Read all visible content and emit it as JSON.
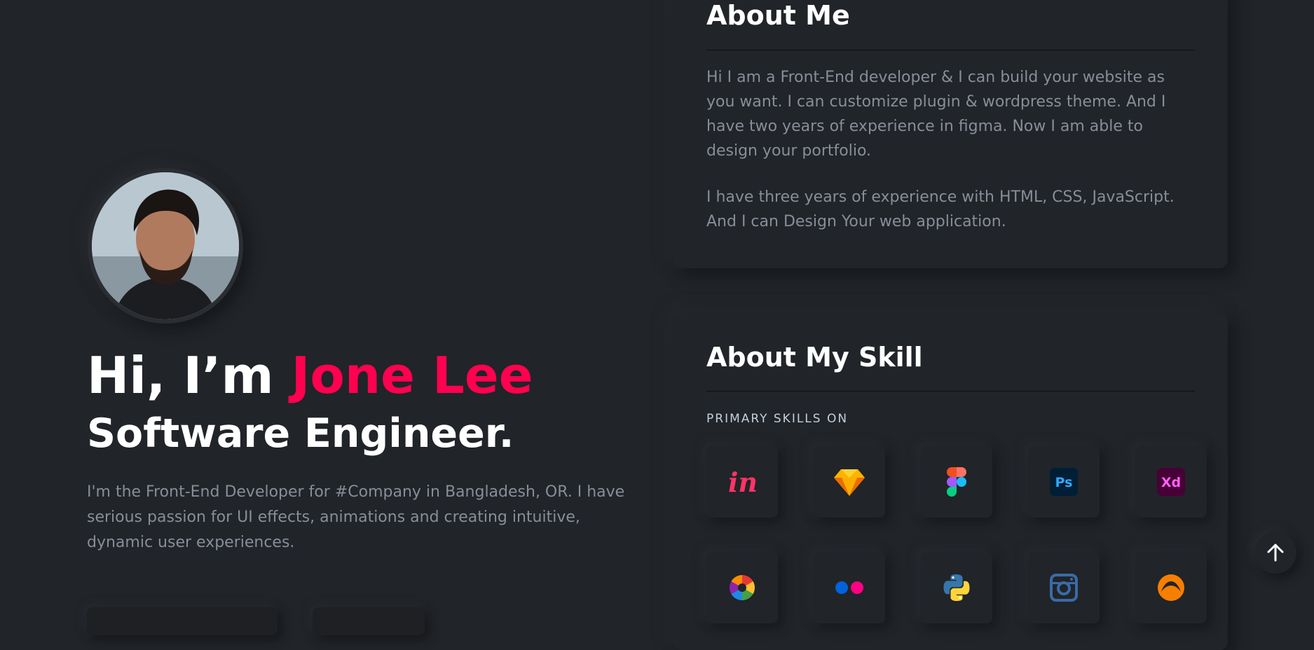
{
  "hero": {
    "greeting": "Hi, I’m",
    "name": "Jone Lee",
    "role": "Software Engineer.",
    "description": "I'm the Front-End Developer for #Company in Bangladesh, OR. I have serious passion for UI effects, animations and creating intuitive, dynamic user experiences."
  },
  "about": {
    "title": "About Me",
    "paragraphs": [
      "Hi I am a Front-End developer & I can build your website as you want. I can customize plugin & wordpress theme. And I have two years of experience in figma. Now I am able to design your portfolio.",
      "I have three years of experience with HTML, CSS, JavaScript. And I can Design Your web application."
    ]
  },
  "skills": {
    "title": "About My Skill",
    "label": "PRIMARY SKILLS ON",
    "icons": [
      {
        "name": "invision-icon",
        "text": "in"
      },
      {
        "name": "sketch-icon"
      },
      {
        "name": "figma-icon"
      },
      {
        "name": "photoshop-icon",
        "text": "Ps"
      },
      {
        "name": "adobe-xd-icon",
        "text": "Xd"
      },
      {
        "name": "picasa-icon"
      },
      {
        "name": "flickr-icon"
      },
      {
        "name": "python-icon"
      },
      {
        "name": "instagram-icon"
      },
      {
        "name": "grooveshark-icon"
      }
    ]
  },
  "colors": {
    "accent": "#ff014f",
    "background": "#212428",
    "text_muted": "#878e99"
  }
}
